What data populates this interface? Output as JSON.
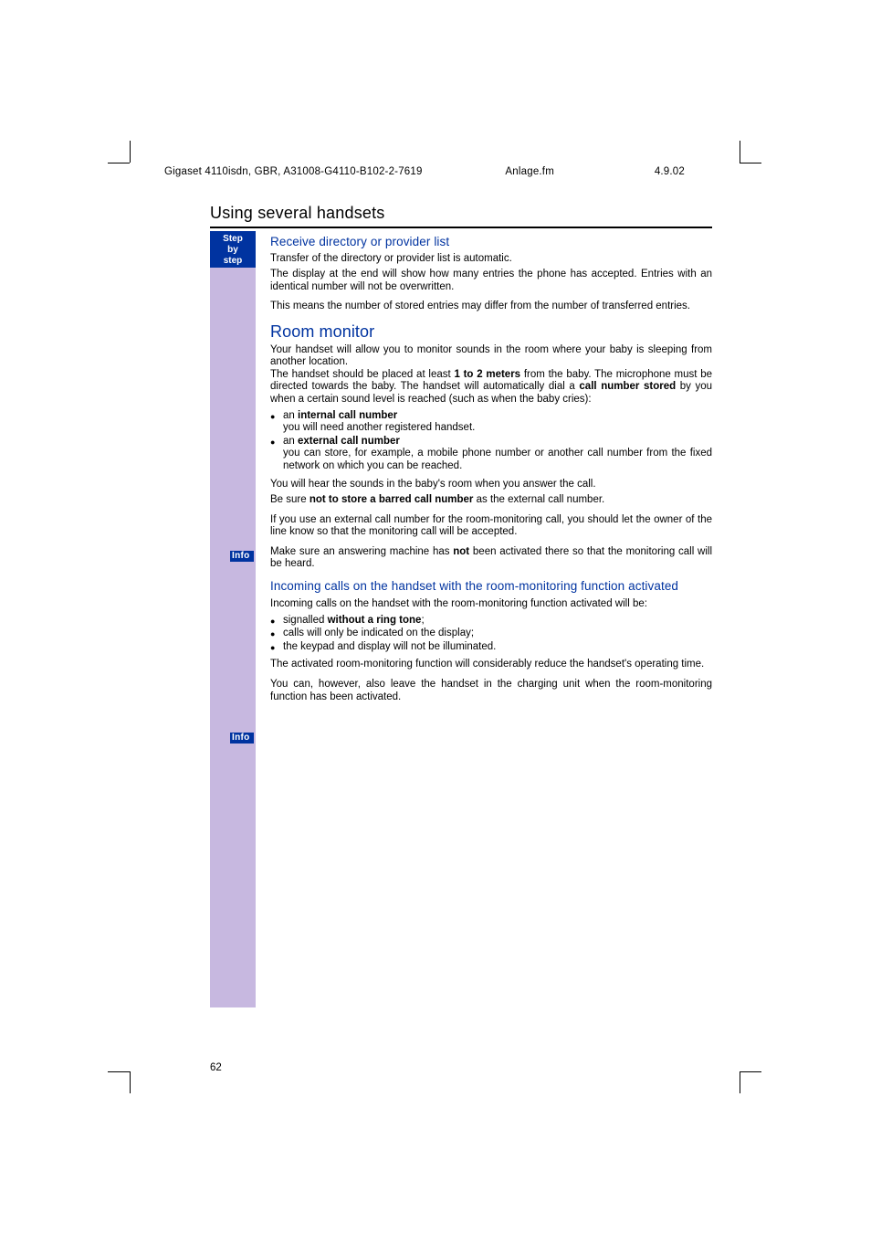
{
  "header": {
    "left": "Gigaset 4110isdn, GBR, A31008-G4110-B102-2-7619",
    "mid": "Anlage.fm",
    "right": "4.9.02"
  },
  "section_title": "Using several handsets",
  "sidebar": {
    "line1": "Step",
    "line2": "by",
    "line3": "step"
  },
  "info_label": "Info",
  "h_receive": "Receive directory or provider list",
  "p_receive_1": "Transfer of the directory or provider list is automatic.",
  "p_receive_2": "The display at the end will show how many entries the phone has accepted. Entries with an identical number will not be overwritten.",
  "p_receive_3": "This means the number of stored entries may differ from the number of transferred entries.",
  "h_room": "Room monitor",
  "p_room_1a": "Your handset will allow you to monitor sounds in the room where your baby is sleeping from another location.",
  "p_room_1b_pre": "The handset should be placed at least ",
  "p_room_1b_bold": "1 to 2 meters",
  "p_room_1b_post": " from the baby. The microphone must be directed towards the baby. The handset will automatically dial a ",
  "p_room_1b_bold2": "call number stored",
  "p_room_1b_post2": " by you when a certain sound level is reached (such as when the baby cries):",
  "li_int_head": "internal call number",
  "li_int_sub": "you will need another registered handset.",
  "li_ext_head": "external call number",
  "li_ext_sub": "you can store, for example, a mobile phone number or another call number from the fixed network on which you can be reached.",
  "p_room_2": "You will hear the sounds in the baby's room when you answer the call.",
  "p_info1_pre": "Be sure ",
  "p_info1_bold": "not to store a barred call number",
  "p_info1_post": " as the external call number.",
  "p_room_3": "If you use an external call number for the room-monitoring call, you should let the owner of the line know so that the monitoring call will be accepted.",
  "p_room_4_pre": "Make sure an answering machine has ",
  "p_room_4_bold": "not",
  "p_room_4_post": " been activated there so that the monitoring call will be heard.",
  "h_incoming": "Incoming calls on the handset with the room-monitoring function activated",
  "p_inc_1": "Incoming calls on the handset with the room-monitoring function activated will be:",
  "li_inc_1_pre": "signalled ",
  "li_inc_1_bold": "without a ring tone",
  "li_inc_1_post": ";",
  "li_inc_2": "calls will only be indicated on the display;",
  "li_inc_3": "the keypad and display will not be illuminated.",
  "p_info2": "The activated room-monitoring function will considerably reduce the handset's operating time.",
  "p_inc_2": "You can, however, also leave the handset in the charging unit when the room-monitoring function has been activated.",
  "page_number": "62"
}
